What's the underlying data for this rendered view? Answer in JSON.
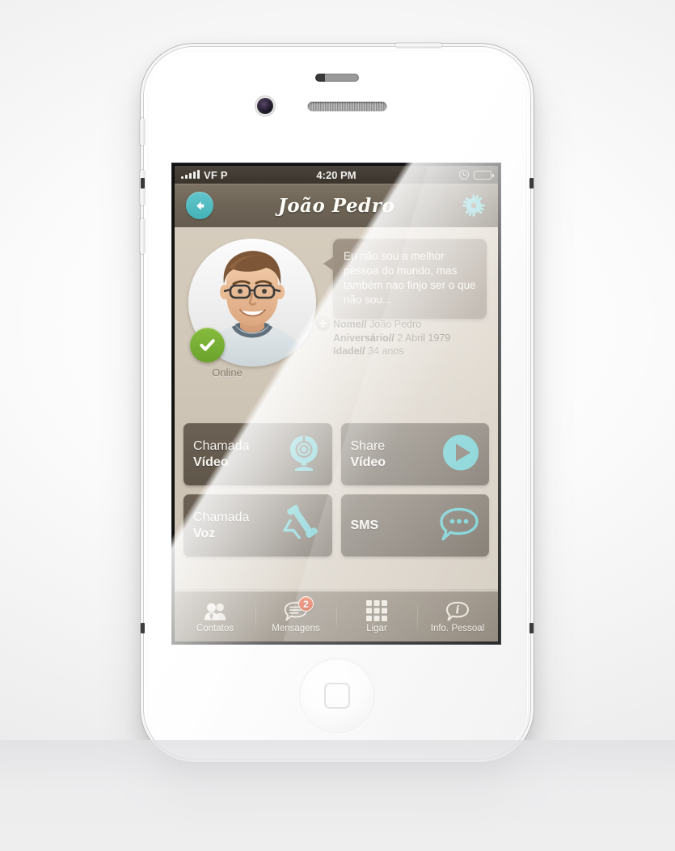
{
  "device": {
    "name": "iPhone 4 white"
  },
  "statusbar": {
    "carrier": "VF P",
    "time": "4:20 PM",
    "signal_icon": "signal-bars-icon",
    "clock_icon": "alarm-clock-icon",
    "battery_icon": "battery-full-icon"
  },
  "navbar": {
    "title": "João Pedro",
    "back_icon": "back-arrow-icon",
    "settings_icon": "gear-icon",
    "accent": "#4fb9bf"
  },
  "profile": {
    "avatar_alt": "contact-photo",
    "status_text": "Online",
    "status_color": "#74ab2f",
    "status_icon": "check-icon",
    "quote": "Eu não sou a melhor pessoa do mundo, mas também nao finjo ser o que não sou...",
    "add_icon": "plus-icon",
    "fields": [
      {
        "label": "Nome//",
        "value": "João Pedro"
      },
      {
        "label": "Aniversário//",
        "value": "2 Abril 1979"
      },
      {
        "label": "Idade//",
        "value": "34 anos"
      }
    ]
  },
  "actions": [
    {
      "line1": "Chamada",
      "line2": "Vídeo",
      "icon": "webcam-icon"
    },
    {
      "line1": "Share",
      "line2": "Vídeo",
      "icon": "play-icon"
    },
    {
      "line1": "Chamada",
      "line2": "Voz",
      "icon": "phone-handset-icon"
    },
    {
      "line1": "SMS",
      "line2": "",
      "icon": "chat-bubble-icon"
    }
  ],
  "tabbar": {
    "items": [
      {
        "label": "Contatos",
        "icon": "contacts-icon",
        "badge": ""
      },
      {
        "label": "Mensagens",
        "icon": "messages-icon",
        "badge": "2"
      },
      {
        "label": "Ligar",
        "icon": "keypad-icon",
        "badge": ""
      },
      {
        "label": "Info. Pessoal",
        "icon": "info-icon",
        "badge": ""
      }
    ],
    "badge_color": "#d9411e"
  }
}
